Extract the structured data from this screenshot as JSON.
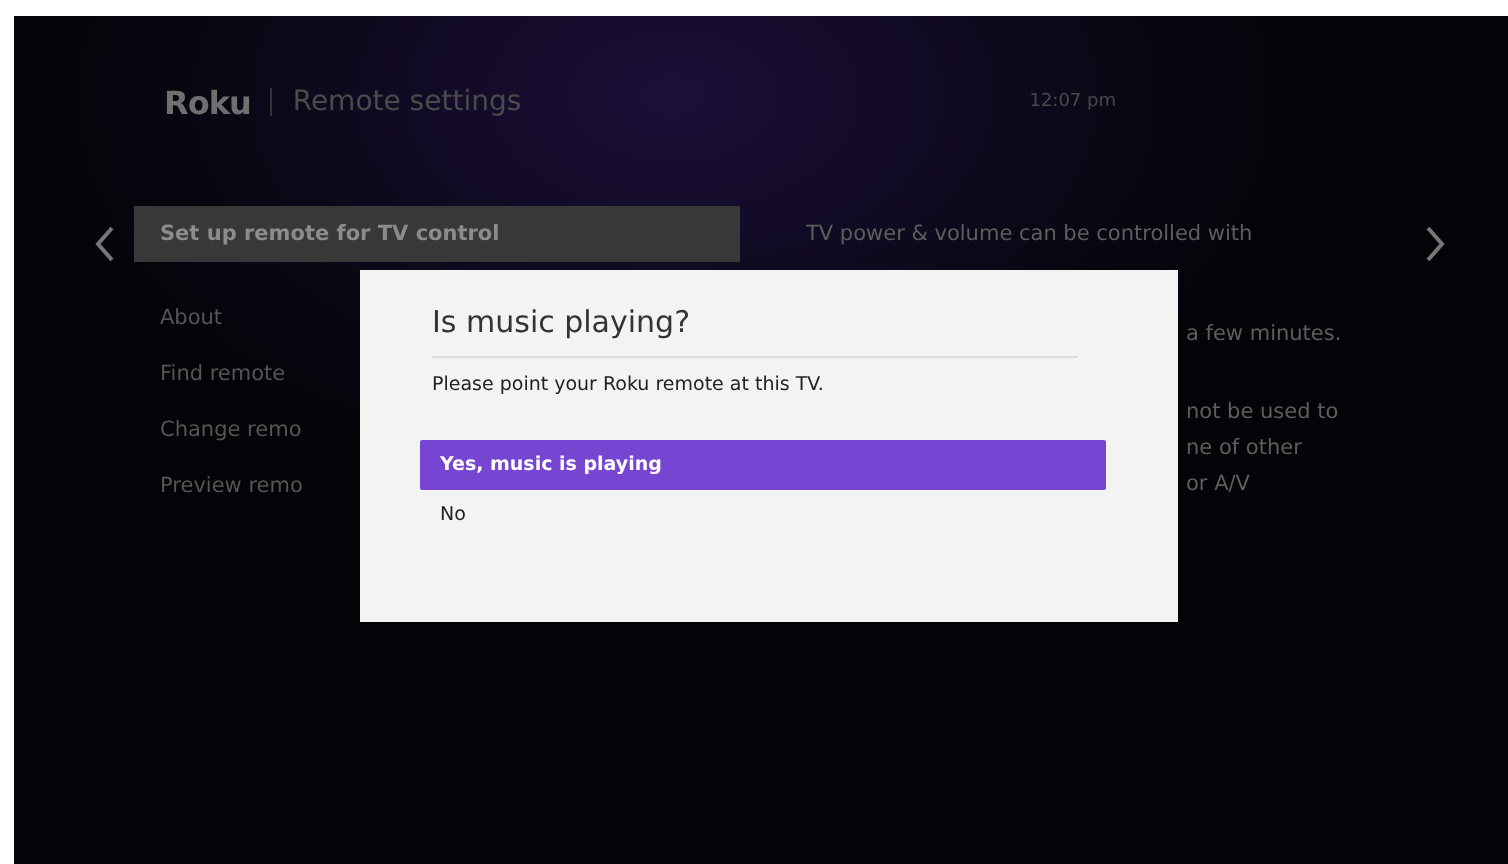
{
  "header": {
    "logo": "Roku",
    "title": "Remote settings",
    "time": "12:07 pm"
  },
  "menu": [
    {
      "label": "Set up remote for TV control",
      "selected": true
    },
    {
      "label": "About",
      "selected": false
    },
    {
      "label": "Find remote",
      "selected": false
    },
    {
      "label": "Change remo",
      "selected": false
    },
    {
      "label": "Preview remo",
      "selected": false
    }
  ],
  "description": [
    [
      "TV power & volume can be controlled with"
    ],
    [
      "a few minutes."
    ],
    [
      "not be used to",
      "ne of other",
      "or A/V"
    ]
  ],
  "dialog": {
    "title": "Is music playing?",
    "message": "Please point your Roku remote at this TV.",
    "options": [
      {
        "label": "Yes, music is playing",
        "selected": true
      },
      {
        "label": "No",
        "selected": false
      }
    ]
  }
}
